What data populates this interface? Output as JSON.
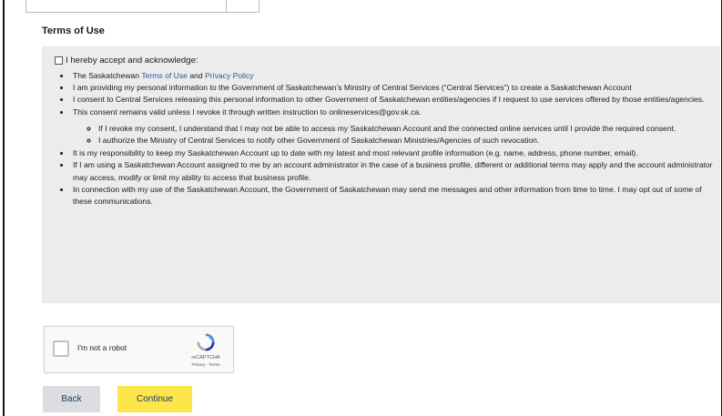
{
  "terms": {
    "heading": "Terms of Use",
    "accept_label": "I hereby accept and acknowledge:",
    "bullet1_prefix": "The Saskatchewan ",
    "bullet1_link1": "Terms of Use",
    "bullet1_and": " and ",
    "bullet1_link2": "Privacy Policy",
    "bullet2": "I am providing my personal information to the Government of Saskatchewan’s Ministry of Central Services (“Central Services”) to create a Saskatchewan Account",
    "bullet3": "I consent to Central Services releasing this personal information to other Government of Saskatchewan entities/agencies if I request to use services offered by those entities/agencies.",
    "bullet4": "This consent remains valid unless I revoke it through written instruction to onlineservices@gov.sk.ca.",
    "sub1": "If I revoke my consent, I understand that I may not be able to access my Saskatchewan Account and the connected online services until I provide the required consent.",
    "sub2": "I authorize the Ministry of Central Services to notify other Government of Saskatchewan Ministries/Agencies of such revocation.",
    "bullet5": "It is my responsibility to keep my Saskatchewan Account up to date with my latest and most relevant profile information (e.g. name, address, phone number, email).",
    "bullet6": "If I am using a Saskatchewan Account assigned to me by an account administrator in the case of a business profile, different or additional terms may apply and the account administrator may access, modify or limit my ability to access that business profile.",
    "bullet7": "In connection with my use of the Saskatchewan Account, the Government of Saskatchewan may send me messages and other information from time to time. I may opt out of some of these communications."
  },
  "captcha": {
    "label": "I'm not a robot",
    "brand": "reCAPTCHA",
    "links": "Privacy - Terms"
  },
  "buttons": {
    "back": "Back",
    "continue": "Continue"
  },
  "colors": {
    "panel_bg": "#ececec",
    "link": "#1d5fa3",
    "continue_bg": "#fde64b",
    "back_bg": "#dcdde0"
  }
}
